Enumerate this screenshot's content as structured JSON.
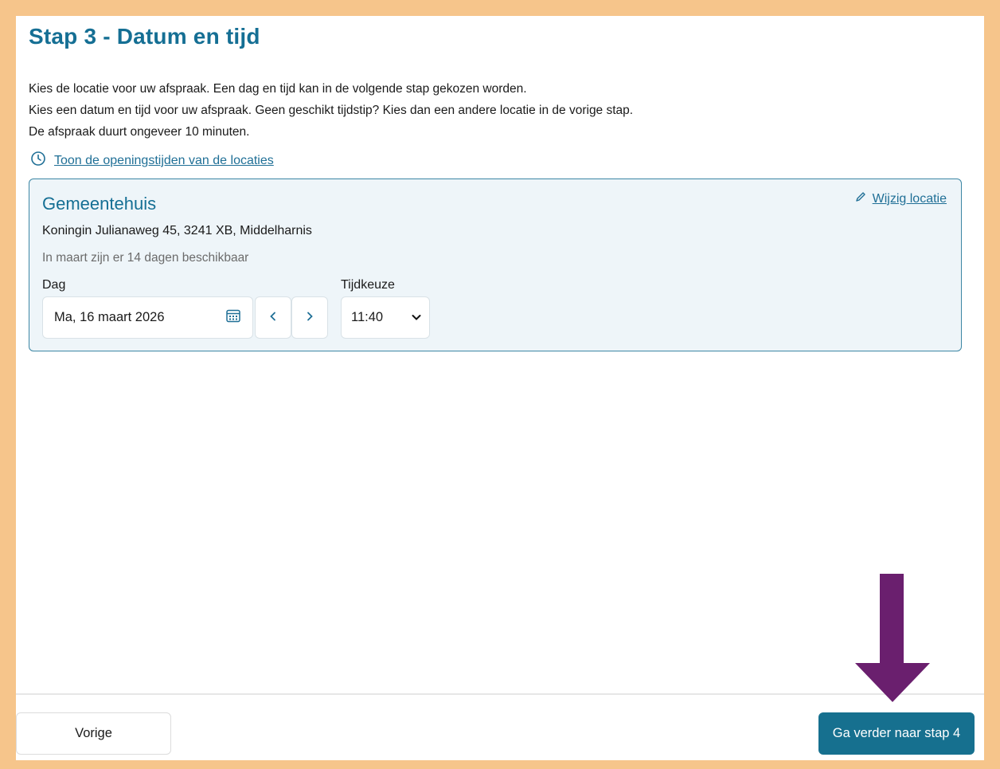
{
  "page": {
    "title": "Stap 3 - Datum en tijd",
    "intro_lines": [
      "Kies de locatie voor uw afspraak. Een dag en tijd kan in de volgende stap gekozen worden.",
      "Kies een datum en tijd voor uw afspraak. Geen geschikt tijdstip? Kies dan een andere locatie in de vorige stap.",
      "De afspraak duurt ongeveer 10 minuten."
    ],
    "hours_link": "Toon de openingstijden van de locaties"
  },
  "location": {
    "name": "Gemeentehuis",
    "change_label": "Wijzig locatie",
    "address": "Koningin Julianaweg 45, 3241 XB, Middelharnis",
    "availability": "In maart zijn er 14 dagen beschikbaar",
    "day_label": "Dag",
    "day_value": "Ma, 16 maart 2026",
    "time_label": "Tijdkeuze",
    "time_value": "11:40"
  },
  "footer": {
    "prev_label": "Vorige",
    "next_label": "Ga verder naar stap 4"
  },
  "icons": {
    "clock": "clock-icon",
    "pencil": "pencil-icon",
    "calendar": "calendar-icon",
    "prev": "chevron-left-icon",
    "next": "chevron-right-icon",
    "dropdown": "chevron-down-icon",
    "annotation": "arrow-down-icon"
  },
  "colors": {
    "frame": "#f6c58b",
    "accent": "#156f94",
    "primary_button": "#16708f",
    "card_bg": "#eef5f9",
    "annotation_arrow": "#6a1f6e"
  }
}
